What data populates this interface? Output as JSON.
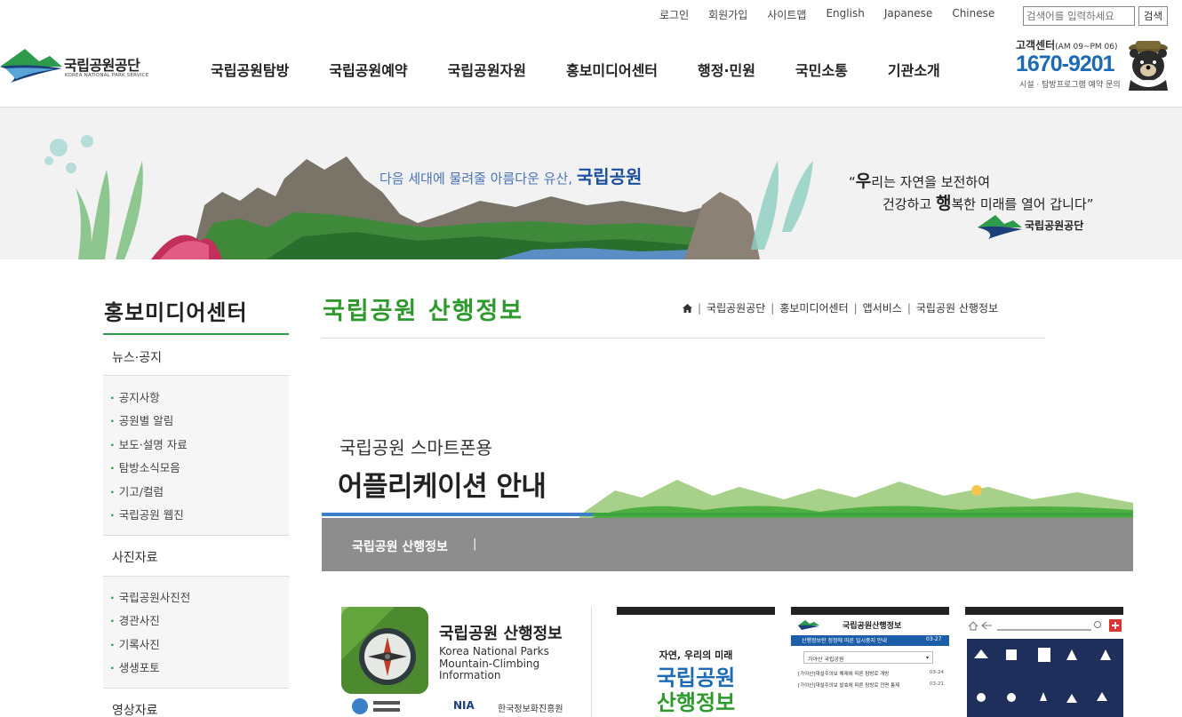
{
  "utility": {
    "links": [
      "로그인",
      "회원가입",
      "사이트맵",
      "English",
      "Japanese",
      "Chinese"
    ],
    "search_placeholder": "검색어를 입력하세요",
    "search_button": "검색"
  },
  "header": {
    "logo_title": "국립공원공단",
    "logo_sub": "KOREA NATIONAL PARK SERVICE",
    "nav": [
      "국립공원탐방",
      "국립공원예약",
      "국립공원자원",
      "홍보미디어센터",
      "행정·민원",
      "국민소통",
      "기관소개"
    ],
    "customer_center": {
      "label": "고객센터",
      "hours": "(AM 09~PM 06)",
      "phone": "1670-9201",
      "desc": "시설 · 탐방프로그램 예약 문의"
    }
  },
  "banner": {
    "tagline_prefix": "다음 세대에 물려줄 아름다운 유산,",
    "tagline_strong": "국립공원",
    "quote_line1_a": "“",
    "quote_line1_b": "우",
    "quote_line1_c": "리는 자연을 보전하여",
    "quote_line2_a": "건강하고 ",
    "quote_line2_b": "행",
    "quote_line2_c": "복한 미래를 열어 갑니다”",
    "org": "국립공원공단"
  },
  "sidebar": {
    "title": "홍보미디어센터",
    "groups": [
      {
        "label": "뉴스·공지",
        "items": [
          "공지사항",
          "공원별 알림",
          "보도·설명 자료",
          "탐방소식모음",
          "기고/컬럼",
          "국립공원 웹진"
        ]
      },
      {
        "label": "사진자료",
        "items": [
          "국립공원사진전",
          "경관사진",
          "기록사진",
          "생생포토"
        ]
      },
      {
        "label": "영상자료",
        "items": []
      }
    ]
  },
  "content": {
    "title": "국립공원 산행정보",
    "breadcrumb": [
      "국립공원공단",
      "홍보미디어센터",
      "앱서비스",
      "국립공원 산행정보"
    ],
    "app_banner": {
      "sub": "국립공원 스마트폰용",
      "main": "어플리케이션 안내",
      "tab": "국립공원 산행정보"
    },
    "app_card": {
      "name": "국립공원 산행정보",
      "en_line1": "Korea National Parks",
      "en_line2": "Mountain-Climbing",
      "en_line3": "Information",
      "footer_logo": "NIA",
      "footer_text": "한국정보화진흥원"
    },
    "screens": {
      "s1_line1": "자연, 우리의 미래",
      "s1_line2": "국립공원",
      "s1_line3": "산행정보",
      "s2_title": "국립공원산행정보",
      "s2_notice": "산행정보란 정정에 따른 일시중지 안내",
      "s2_date": "03-27",
      "s2_select": "가야산 국립공원",
      "s2_row1": "[가야산]대설주의보 해제에 따른 탐방로 개방",
      "s2_row1_date": "03-24",
      "s2_row2": "[가야산]대설주의보 발효에 따른 탐방로 전면 통제",
      "s2_row2_date": "03-21"
    }
  },
  "colors": {
    "green": "#2e9a2e",
    "blue": "#1d6bb5",
    "navy": "#1a3f7a"
  }
}
